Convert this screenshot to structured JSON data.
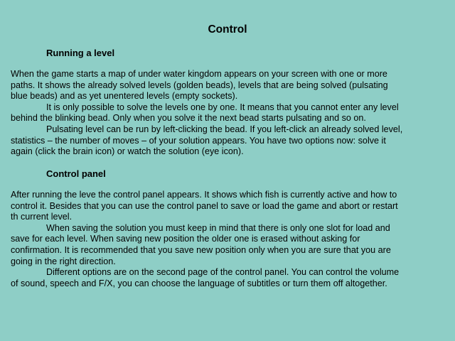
{
  "page": {
    "title": "Control"
  },
  "section_running": {
    "heading": "Running a level",
    "lines": [
      "When the game starts a map of under water kingdom appears on your screen with one or more",
      "paths. It shows the already solved levels (golden beads), levels that are being solved (pulsating",
      "blue beads) and as yet unentered levels (empty sockets).",
      "It is only possible to solve the levels one by one. It means that you cannot enter any level",
      "behind the blinking bead. Only when you solve it the next bead starts pulsating and so on.",
      "Pulsating level can be run by left-clicking the bead. If you left-click an already solved level,",
      "statistics – the number of moves – of your solution appears. You have two options now: solve it",
      "again (click the brain icon) or watch the solution (eye icon)."
    ]
  },
  "section_panel": {
    "heading": "Control panel",
    "lines": [
      "After running the leve the control panel appears. It shows which fish is currently active and how to",
      "control it. Besides that you can use the control panel to save or load the game and abort or restart",
      "th current level.",
      "When saving the solution you must keep in mind that there is only one slot for load and",
      "save for each level. When saving new position the older one is erased without asking for",
      "confirmation. It is recommended that you save new position only when you are sure that you are",
      "going in the right direction.",
      "Different options are on the second page of the control panel. You can control the volume",
      "of sound, speech and F/X, you can choose the language of subtitles or turn them off altogether."
    ]
  }
}
